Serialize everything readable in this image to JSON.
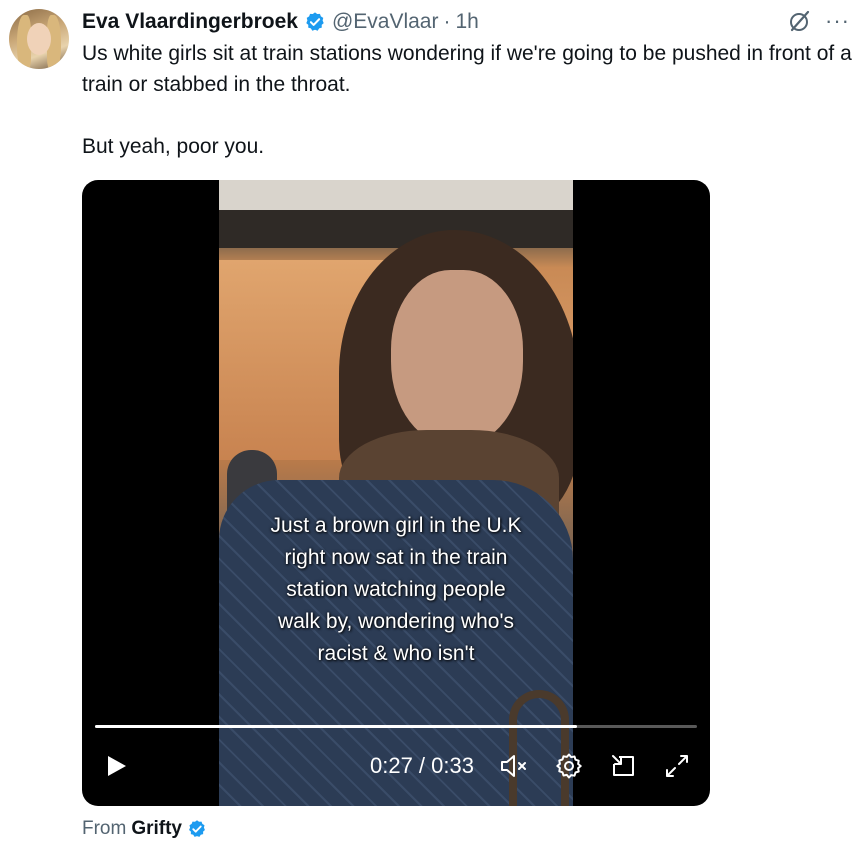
{
  "author": {
    "name": "Eva Vlaardingerbroek",
    "handle": "@EvaVlaar",
    "separator": "·",
    "time": "1h",
    "verified_icon": "verified-badge-icon"
  },
  "top_actions": {
    "grok_icon": "grok-icon",
    "more_label": "···"
  },
  "tweet": {
    "paragraph_1": "Us white girls sit at train stations wondering if we're going to be pushed in front of a train or stabbed in the throat.",
    "paragraph_2": "But yeah, poor you."
  },
  "video": {
    "caption_lines": [
      "Just a brown girl in the U.K",
      "right now sat in the train",
      "station watching people",
      "walk by, wondering who's",
      "racist & who isn't"
    ],
    "timecode": "0:27 / 0:33",
    "progress": 0.8,
    "icons": [
      "play-icon",
      "mute-icon",
      "settings-icon",
      "pip-icon",
      "fullscreen-icon"
    ]
  },
  "source": {
    "prefix": "From",
    "name": "Grifty"
  },
  "colors": {
    "verified": "#1d9bf0",
    "text": "#0f1419",
    "secondary": "#536471"
  }
}
